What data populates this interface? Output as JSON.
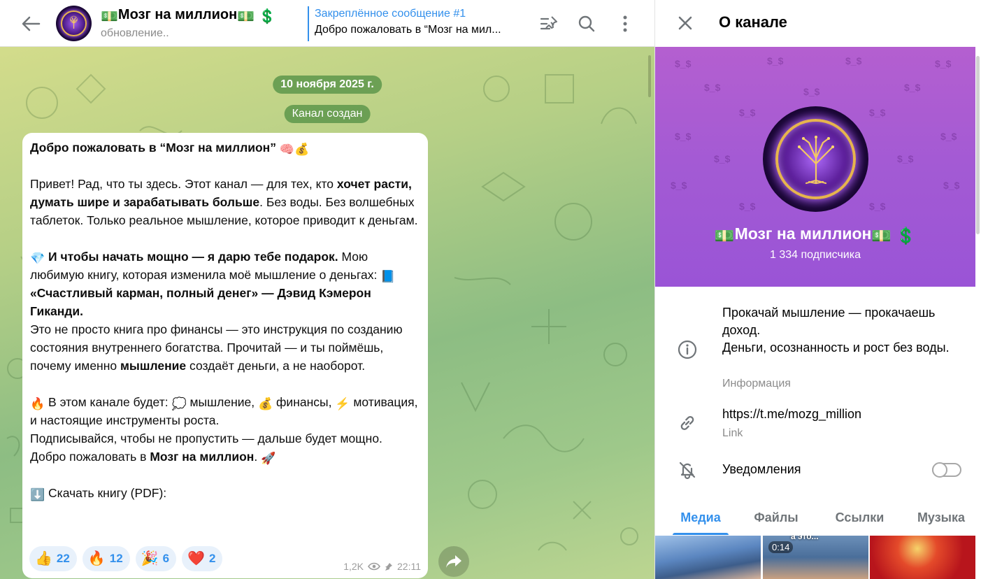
{
  "chat": {
    "title": "Мозг на миллион",
    "title_emoji_left": "💵",
    "title_emoji_right": "💵 💲",
    "status": "обновление..",
    "pinned": {
      "title": "Закреплённое сообщение #1",
      "text": "Добро пожаловать в “Мозг на мил..."
    },
    "date_pill": "10 ноября 2025 г.",
    "service_pill": "Канал создан",
    "message": {
      "heading": "Добро пожаловать в “Мозг на миллион”",
      "heading_emoji": "🧠💰",
      "p1_pre": "Привет! Рад, что ты здесь. Этот канал — для тех, кто ",
      "p1_bold": "хочет расти, думать шире и зарабатывать больше",
      "p1_post": ". Без воды. Без волшебных таблеток. Только реальное мышление, которое приводит к деньгам.",
      "p2_emoji": "💎",
      "p2_bold": "И чтобы начать мощно — я дарю тебе подарок.",
      "p2_mid": " Мою любимую книгу, которая изменила моё мышление о деньгах: ",
      "p2_book_emoji": "📘",
      "p2_book_bold": "«Счастливый карман, полный денег» — Дэвид Кэмерон Гиканди.",
      "p2_line2_pre": "Это не просто книга про финансы — это инструкция по созданию состояния внутреннего богатства. Прочитай — и ты поймёшь, почему именно ",
      "p2_line2_bold": "мышление",
      "p2_line2_post": " создаёт деньги, а не наоборот.",
      "p3_emoji": "🔥",
      "p3_a": " В этом канале будет: ",
      "p3_e1": "💭",
      "p3_b": " мышление, ",
      "p3_e2": "💰",
      "p3_c": " финансы, ",
      "p3_e3": "⚡",
      "p3_d": " мотивация, и настоящие инструменты роста.",
      "p3_line2_pre": "Подписывайся, чтобы не пропустить — дальше будет мощно. Добро пожаловать в ",
      "p3_line2_bold": "Мозг на миллион",
      "p3_line2_post": ". ",
      "p3_rocket": "🚀",
      "p4_emoji": "⬇️",
      "p4_text": " Скачать книгу (PDF):",
      "views": "1,2K",
      "time": "22:11",
      "reactions": [
        {
          "emoji": "👍",
          "count": "22"
        },
        {
          "emoji": "🔥",
          "count": "12"
        },
        {
          "emoji": "🎉",
          "count": "6"
        },
        {
          "emoji": "❤️",
          "count": "2"
        }
      ]
    }
  },
  "panel": {
    "title": "О канале",
    "channel_name": "Мозг на миллион",
    "name_emoji_left": "💵",
    "name_emoji_right": "💵 💲",
    "subscribers": "1 334 подписчика",
    "pattern_text": "$_$",
    "description": "Прокачай мышление — прокачаешь доход.\nДеньги, осознанность и рост без воды.",
    "description_label": "Информация",
    "link": "https://t.me/mozg_million",
    "link_label": "Link",
    "notifications_label": "Уведомления",
    "notifications_on": false,
    "tabs": [
      "Медиа",
      "Файлы",
      "Ссылки",
      "Музыка"
    ],
    "active_tab": "Медиа",
    "media": [
      {
        "duration": "",
        "caption": ""
      },
      {
        "duration": "0:14",
        "caption": "а это..."
      },
      {
        "duration": "",
        "caption": ""
      }
    ]
  },
  "colors": {
    "accent": "#3390ec",
    "hero_bg": "#a85ad2",
    "chat_bg": "#a9c987"
  },
  "icons": [
    "back-arrow-icon",
    "pinned-list-icon",
    "search-icon",
    "more-vertical-icon",
    "close-icon",
    "info-icon",
    "link-icon",
    "bell-off-icon",
    "eye-icon",
    "pin-icon",
    "share-icon"
  ]
}
